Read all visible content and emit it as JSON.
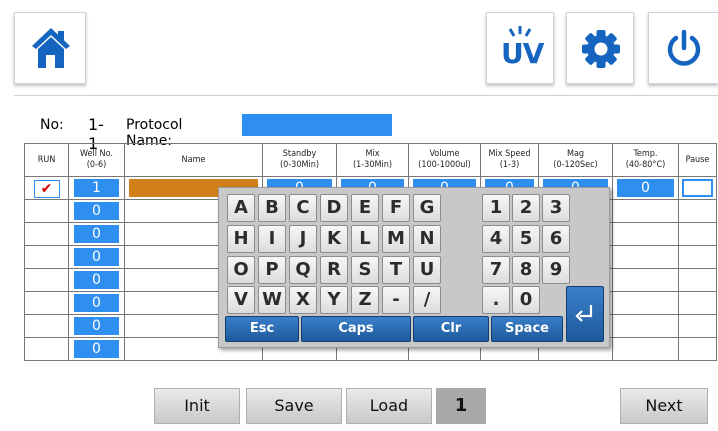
{
  "toolbar": {
    "home_icon": "home-icon",
    "uv_label": "UV",
    "settings_icon": "gear-icon",
    "power_icon": "power-icon"
  },
  "protocol": {
    "no_label": "No:",
    "no_value": "1-1",
    "name_label": "Protocol Name:",
    "name_value": ""
  },
  "table": {
    "headers": {
      "run": "RUN",
      "well_no": "Well No.",
      "well_no_range": "(0-6)",
      "name": "Name",
      "standby": "Standby",
      "standby_range": "(0-30Min)",
      "mix": "Mix",
      "mix_range": "(1-30Min)",
      "volume": "Volume",
      "volume_range": "(100-1000ul)",
      "mix_speed": "Mix Speed",
      "mix_speed_range": "(1-3)",
      "mag": "Mag",
      "mag_range": "(0-120Sec)",
      "temp": "Temp.",
      "temp_range": "(40-80°C)",
      "pause": "Pause"
    },
    "rows": [
      {
        "run_checked": true,
        "run_mark": "✔",
        "well": "1",
        "standby": "0",
        "mix": "0",
        "volume": "0",
        "mix_speed": "0",
        "mag": "0",
        "temp": "0"
      },
      {
        "well": "0"
      },
      {
        "well": "0"
      },
      {
        "well": "0"
      },
      {
        "well": "0"
      },
      {
        "well": "0"
      },
      {
        "well": "0"
      },
      {
        "well": "0"
      }
    ]
  },
  "keyboard": {
    "row1": [
      "A",
      "B",
      "C",
      "D",
      "E",
      "F",
      "G",
      "1",
      "2",
      "3"
    ],
    "row2": [
      "H",
      "I",
      "J",
      "K",
      "L",
      "M",
      "N",
      "4",
      "5",
      "6"
    ],
    "row3": [
      "O",
      "P",
      "Q",
      "R",
      "S",
      "T",
      "U",
      "7",
      "8",
      "9"
    ],
    "row4": [
      "V",
      "W",
      "X",
      "Y",
      "Z",
      "-",
      "/",
      ".",
      "0"
    ],
    "esc": "Esc",
    "caps": "Caps",
    "clr": "Clr",
    "space": "Space",
    "enter_icon": "enter-icon"
  },
  "footer": {
    "init": "Init",
    "save": "Save",
    "load": "Load",
    "page": "1",
    "next": "Next"
  },
  "colors": {
    "accent": "#2f8ff0",
    "name_field": "#d2811a",
    "key_blue": "#1e5a9c",
    "icon_blue": "#1565c0"
  }
}
